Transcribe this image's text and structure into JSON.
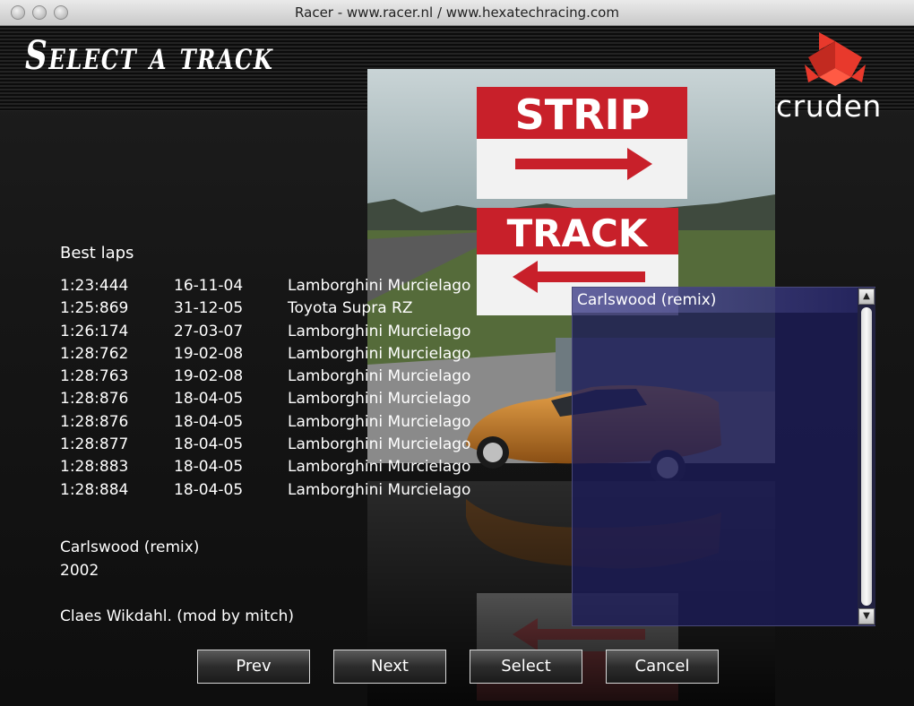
{
  "window": {
    "title": "Racer - www.racer.nl / www.hexatechracing.com"
  },
  "header": {
    "title": "Select a track"
  },
  "logo": {
    "text": "cruden"
  },
  "preview": {
    "sign_top": "STRIP",
    "sign_bottom": "TRACK"
  },
  "best_laps": {
    "title": "Best laps",
    "rows": [
      {
        "time": "1:23:444",
        "date": "16-11-04",
        "car": "Lamborghini Murcielago"
      },
      {
        "time": "1:25:869",
        "date": "31-12-05",
        "car": "Toyota Supra RZ"
      },
      {
        "time": "1:26:174",
        "date": "27-03-07",
        "car": "Lamborghini Murcielago"
      },
      {
        "time": "1:28:762",
        "date": "19-02-08",
        "car": "Lamborghini Murcielago"
      },
      {
        "time": "1:28:763",
        "date": "19-02-08",
        "car": "Lamborghini Murcielago"
      },
      {
        "time": "1:28:876",
        "date": "18-04-05",
        "car": "Lamborghini Murcielago"
      },
      {
        "time": "1:28:876",
        "date": "18-04-05",
        "car": "Lamborghini Murcielago"
      },
      {
        "time": "1:28:877",
        "date": "18-04-05",
        "car": "Lamborghini Murcielago"
      },
      {
        "time": "1:28:883",
        "date": "18-04-05",
        "car": "Lamborghini Murcielago"
      },
      {
        "time": "1:28:884",
        "date": "18-04-05",
        "car": "Lamborghini Murcielago"
      }
    ]
  },
  "track_info": {
    "name": "Carlswood (remix)",
    "year": "2002",
    "author": "Claes Wikdahl. (mod by mitch)"
  },
  "track_list": {
    "items": [
      "Carlswood (remix)"
    ],
    "selected_index": 0
  },
  "buttons": {
    "prev": "Prev",
    "next": "Next",
    "select": "Select",
    "cancel": "Cancel"
  },
  "colors": {
    "sign_red": "#c8202a",
    "logo_red": "#e8392c",
    "list_bg": "#1c1c58"
  }
}
